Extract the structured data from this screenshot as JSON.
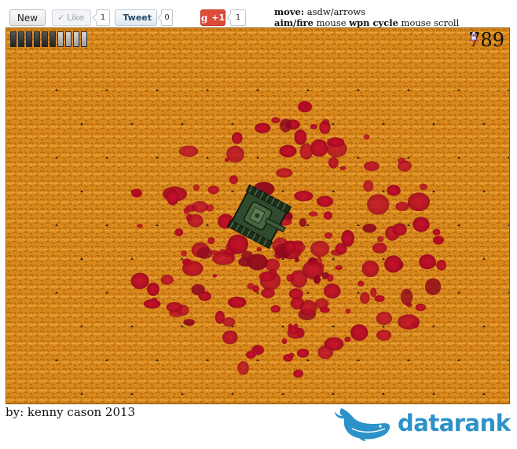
{
  "toolbar": {
    "new_label": "New",
    "like_label": "Like",
    "like_count": "1",
    "tweet_label": "Tweet",
    "tweet_count": "0",
    "gplus_label": "+1",
    "gplus_count": "1"
  },
  "controls_help": {
    "move_key": "move:",
    "move_value": "asdw/arrows",
    "aim_key": "aim/fire",
    "aim_value": "mouse",
    "cycle_key": "wpn cycle",
    "cycle_value": "mouse scroll"
  },
  "hud": {
    "health_total_segments": 10,
    "health_filled_segments": 6,
    "ammo_count": "789",
    "ammo_icon": "rocket-icon"
  },
  "scene": {
    "ground": "sand",
    "player": "tank-icon",
    "splatter": "blood-splatter"
  },
  "footer": {
    "credit": "by: kenny cason 2013",
    "brand": "datarank",
    "brand_icon": "whale-icon",
    "brand_color": "#2c92c9"
  }
}
